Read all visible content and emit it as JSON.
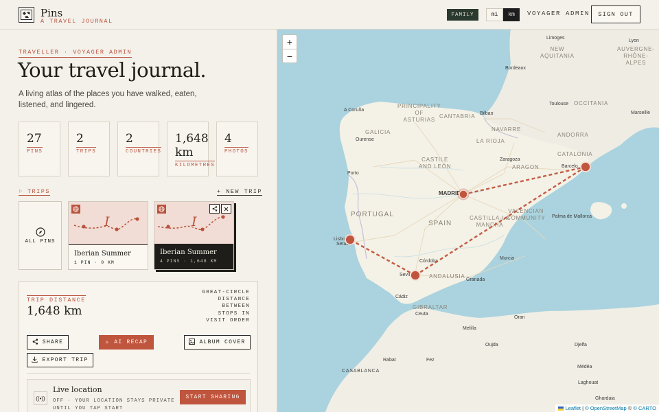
{
  "header": {
    "brand_title": "Pins",
    "brand_subtitle": "A TRAVEL JOURNAL",
    "family_badge": "FAMILY",
    "unit_mi": "mi",
    "unit_km": "km",
    "user_name": "VOYAGER ADMIN",
    "sign_out": "SIGN OUT"
  },
  "hero": {
    "kicker": "TRAVELLER · VOYAGER ADMIN",
    "title": "Your travel journal.",
    "lede": "A living atlas of the places you have walked, eaten, listened, and lingered."
  },
  "stats": [
    {
      "value": "27",
      "label": "PINS"
    },
    {
      "value": "2",
      "label": "TRIPS"
    },
    {
      "value": "2",
      "label": "COUNTRIES"
    },
    {
      "value": "1,648 km",
      "label": "KILOMETRES"
    },
    {
      "value": "4",
      "label": "PHOTOS"
    }
  ],
  "trips": {
    "section_label": "TRIPS",
    "new_trip": "+ NEW TRIP",
    "all_pins": "ALL PINS",
    "cards": [
      {
        "name": "Iberian Summer",
        "meta": "1 PIN · 0 KM",
        "glyph": "I"
      },
      {
        "name": "Iberian Summer",
        "meta": "4 PINS · 1,648 KM",
        "glyph": "I"
      }
    ]
  },
  "trip_panel": {
    "distance_label": "TRIP DISTANCE",
    "distance_value": "1,648 km",
    "distance_note": "GREAT-CIRCLE DISTANCE BETWEEN STOPS IN VISIT ORDER",
    "share": "SHARE",
    "ai_recap": "AI RECAP",
    "album_cover": "ALBUM COVER",
    "export_trip": "EXPORT TRIP",
    "live_title": "Live location",
    "live_desc": "OFF · YOUR LOCATION STAYS PRIVATE UNTIL YOU TAP START",
    "start_sharing": "START SHARING"
  },
  "map": {
    "zoom_in": "+",
    "zoom_out": "−",
    "attribution_leaflet": "Leaflet",
    "attribution_osm": "© OpenStreetMap",
    "attribution_carto": "© CARTO",
    "attribution_sep1": " | ",
    "attribution_sep2": " © ",
    "route_color": "#c0553e",
    "labels": {
      "limoges": "Limoges",
      "lyon": "Lyon",
      "new_aquitania": "NEW\nAQUITANIA",
      "auvergne": "AUVERGNE-\nRHÔNE-\nALPES",
      "bordeaux": "Bordeaux",
      "coruna": "A Coruña",
      "asturias": "PRINCIPALITY\nOF\nASTURIAS",
      "cantabria": "CANTABRIA",
      "bilbao": "Bilbao",
      "toulouse": "Toulouse",
      "occitania": "OCCITANIA",
      "marseille": "Marseille",
      "galicia": "GALICIA",
      "navarre": "NAVARRE",
      "andorra": "ANDORRA",
      "ourense": "Ourense",
      "la_rioja": "LA RIOJA",
      "castile_leon": "CASTILE\nAND LEÓN",
      "zaragoza": "Zaragoza",
      "aragon": "ARAGON",
      "catalonia": "CATALONIA",
      "barcelona": "Barcelo",
      "porto": "Porto",
      "madrid": "MADRID",
      "portugal": "PORTUGAL",
      "spain": "SPAIN",
      "valencian": "VALENCIAN\nCOMMUNITY",
      "castilla_mancha": "CASTILLA-LA\nMANCHA",
      "palma": "Palma de Mallorca",
      "lisbon": "Lisbo",
      "setubal": "Setúbal",
      "cordoba": "Córdoba",
      "murcia": "Murcia",
      "seville": "Sevil",
      "andalusia": "ANDALUSIA",
      "granada": "Granada",
      "cadiz": "Cádiz",
      "gibraltar": "GIBRALTAR",
      "ceuta": "Ceuta",
      "oran": "Oran",
      "melilla": "Melilla",
      "oujda": "Oujda",
      "rabat": "Rabat",
      "fez": "Fez",
      "casablanca": "CASABLANCA",
      "djelfa": "Djelfa",
      "medea": "Médéa",
      "laghouat": "Laghouat",
      "ghardaia": "Ghardaia"
    }
  }
}
